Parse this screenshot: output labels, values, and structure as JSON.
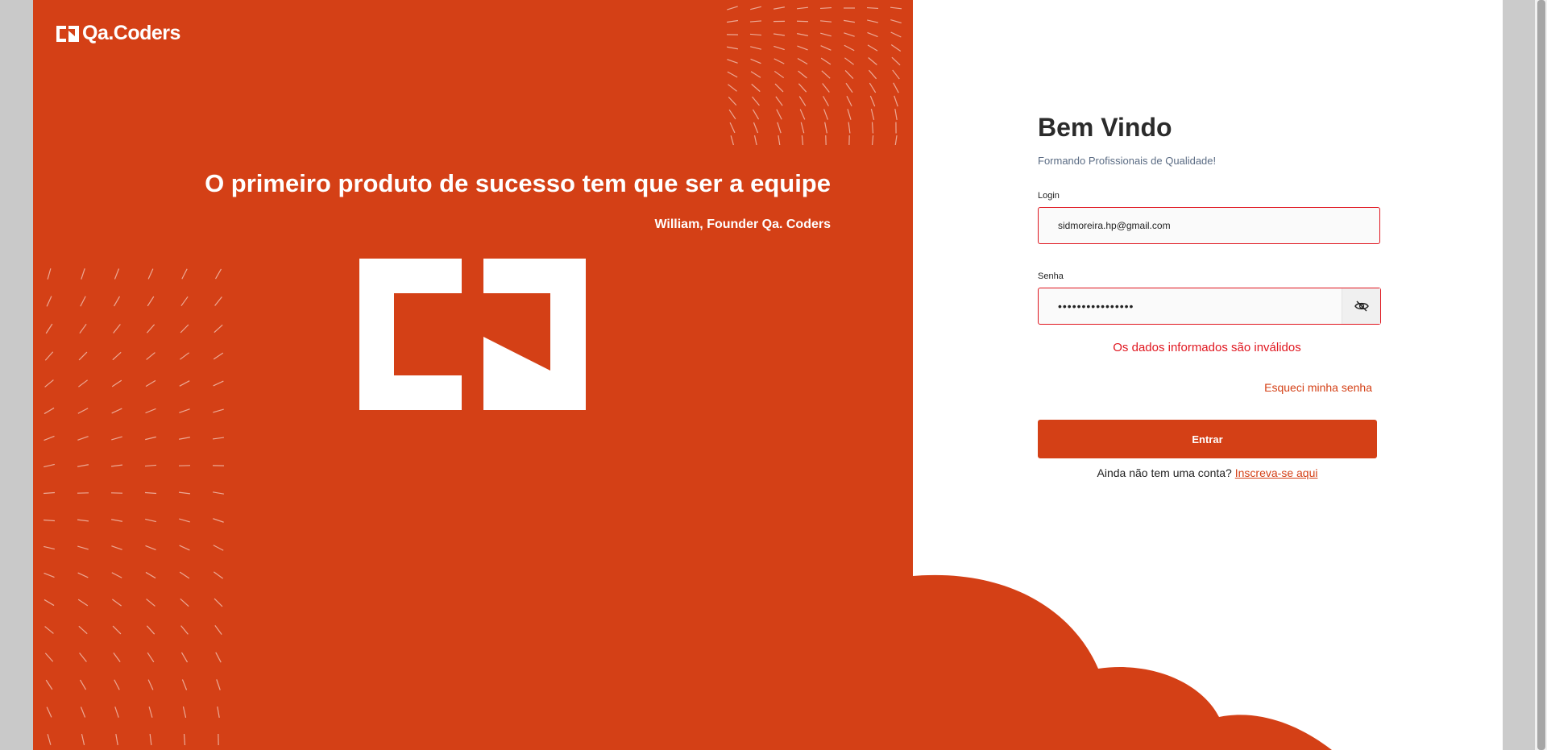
{
  "brand": {
    "name": "Qa.Coders"
  },
  "hero": {
    "quote": "O primeiro produto de sucesso tem que ser a equipe",
    "author": "William, Founder Qa. Coders"
  },
  "form": {
    "title": "Bem Vindo",
    "subtitle": "Formando Profissionais de Qualidade!",
    "login_label": "Login",
    "login_value": "sidmoreira.hp@gmail.com",
    "password_label": "Senha",
    "password_value": "••••••••••••••••",
    "error_message": "Os dados informados são inválidos",
    "forgot_link": "Esqueci minha senha",
    "submit_label": "Entrar",
    "signup_prompt": "Ainda não tem uma conta?",
    "signup_link": "Inscreva-se aqui"
  },
  "colors": {
    "brand_orange": "#d44016",
    "error_red": "#e0161f",
    "subtitle": "#5b6c84",
    "panel_white": "#ffffff"
  },
  "icons": {
    "password_toggle": "eye-slash-icon"
  }
}
